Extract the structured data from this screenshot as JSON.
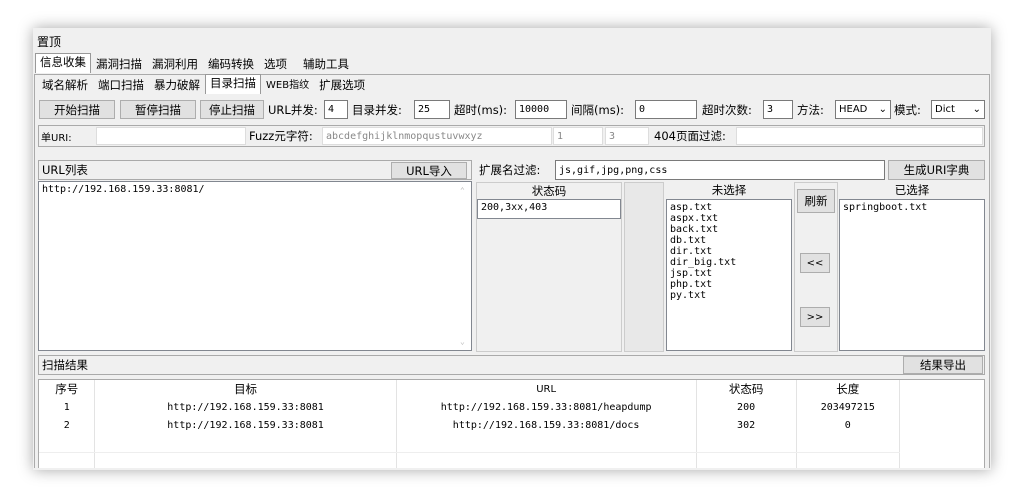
{
  "window": {
    "title": "置顶"
  },
  "main_tabs": [
    "信息收集",
    "漏洞扫描",
    "漏洞利用",
    "编码转换",
    "选项",
    "辅助工具"
  ],
  "sub_tabs": [
    "域名解析",
    "端口扫描",
    "暴力破解",
    "目录扫描",
    "WEB指纹",
    "扩展选项"
  ],
  "toolbar": {
    "start": "开始扫描",
    "pause": "暂停扫描",
    "stop": "停止扫描",
    "url_concurrency_label": "URL并发:",
    "url_concurrency": "4",
    "dir_concurrency_label": "目录并发:",
    "dir_concurrency": "25",
    "timeout_label": "超时(ms):",
    "timeout": "10000",
    "interval_label": "间隔(ms):",
    "interval": "0",
    "timeout_count_label": "超时次数:",
    "timeout_count": "3",
    "method_label": "方法:",
    "method": "HEAD",
    "mode_label": "模式:",
    "mode": "Dict"
  },
  "row2": {
    "single_url_label": "单URI:",
    "fuzz_label": "Fuzz元字符:",
    "fuzz_chars": "abcdefghijklnmopqustuvwxyz",
    "fuzz_min": "1",
    "fuzz_max": "3",
    "filter404_label": "404页面过滤:"
  },
  "url_list": {
    "header": "URL列表",
    "import_button": "URL导入",
    "items": [
      "http://192.168.159.33:8081/"
    ]
  },
  "ext_filter": {
    "label": "扩展名过滤:",
    "value": "js,gif,jpg,png,css",
    "gen_button": "生成URI字典"
  },
  "status_codes": {
    "header": "状态码",
    "items": [
      "200,3xx,403"
    ]
  },
  "unselected": {
    "header": "未选择",
    "items": [
      "asp.txt",
      "aspx.txt",
      "back.txt",
      "db.txt",
      "dir.txt",
      "dir_big.txt",
      "jsp.txt",
      "php.txt",
      "py.txt"
    ]
  },
  "refresh_button": "刷新",
  "move_left": "<<",
  "move_right": ">>",
  "selected": {
    "header": "已选择",
    "items": [
      "springboot.txt"
    ]
  },
  "results": {
    "header": "扫描结果",
    "export_button": "结果导出",
    "columns": [
      "序号",
      "目标",
      "URL",
      "状态码",
      "长度"
    ],
    "rows": [
      [
        "1",
        "http://192.168.159.33:8081",
        "http://192.168.159.33:8081/heapdump",
        "200",
        "203497215"
      ],
      [
        "2",
        "http://192.168.159.33:8081",
        "http://192.168.159.33:8081/docs",
        "302",
        "0"
      ]
    ]
  }
}
